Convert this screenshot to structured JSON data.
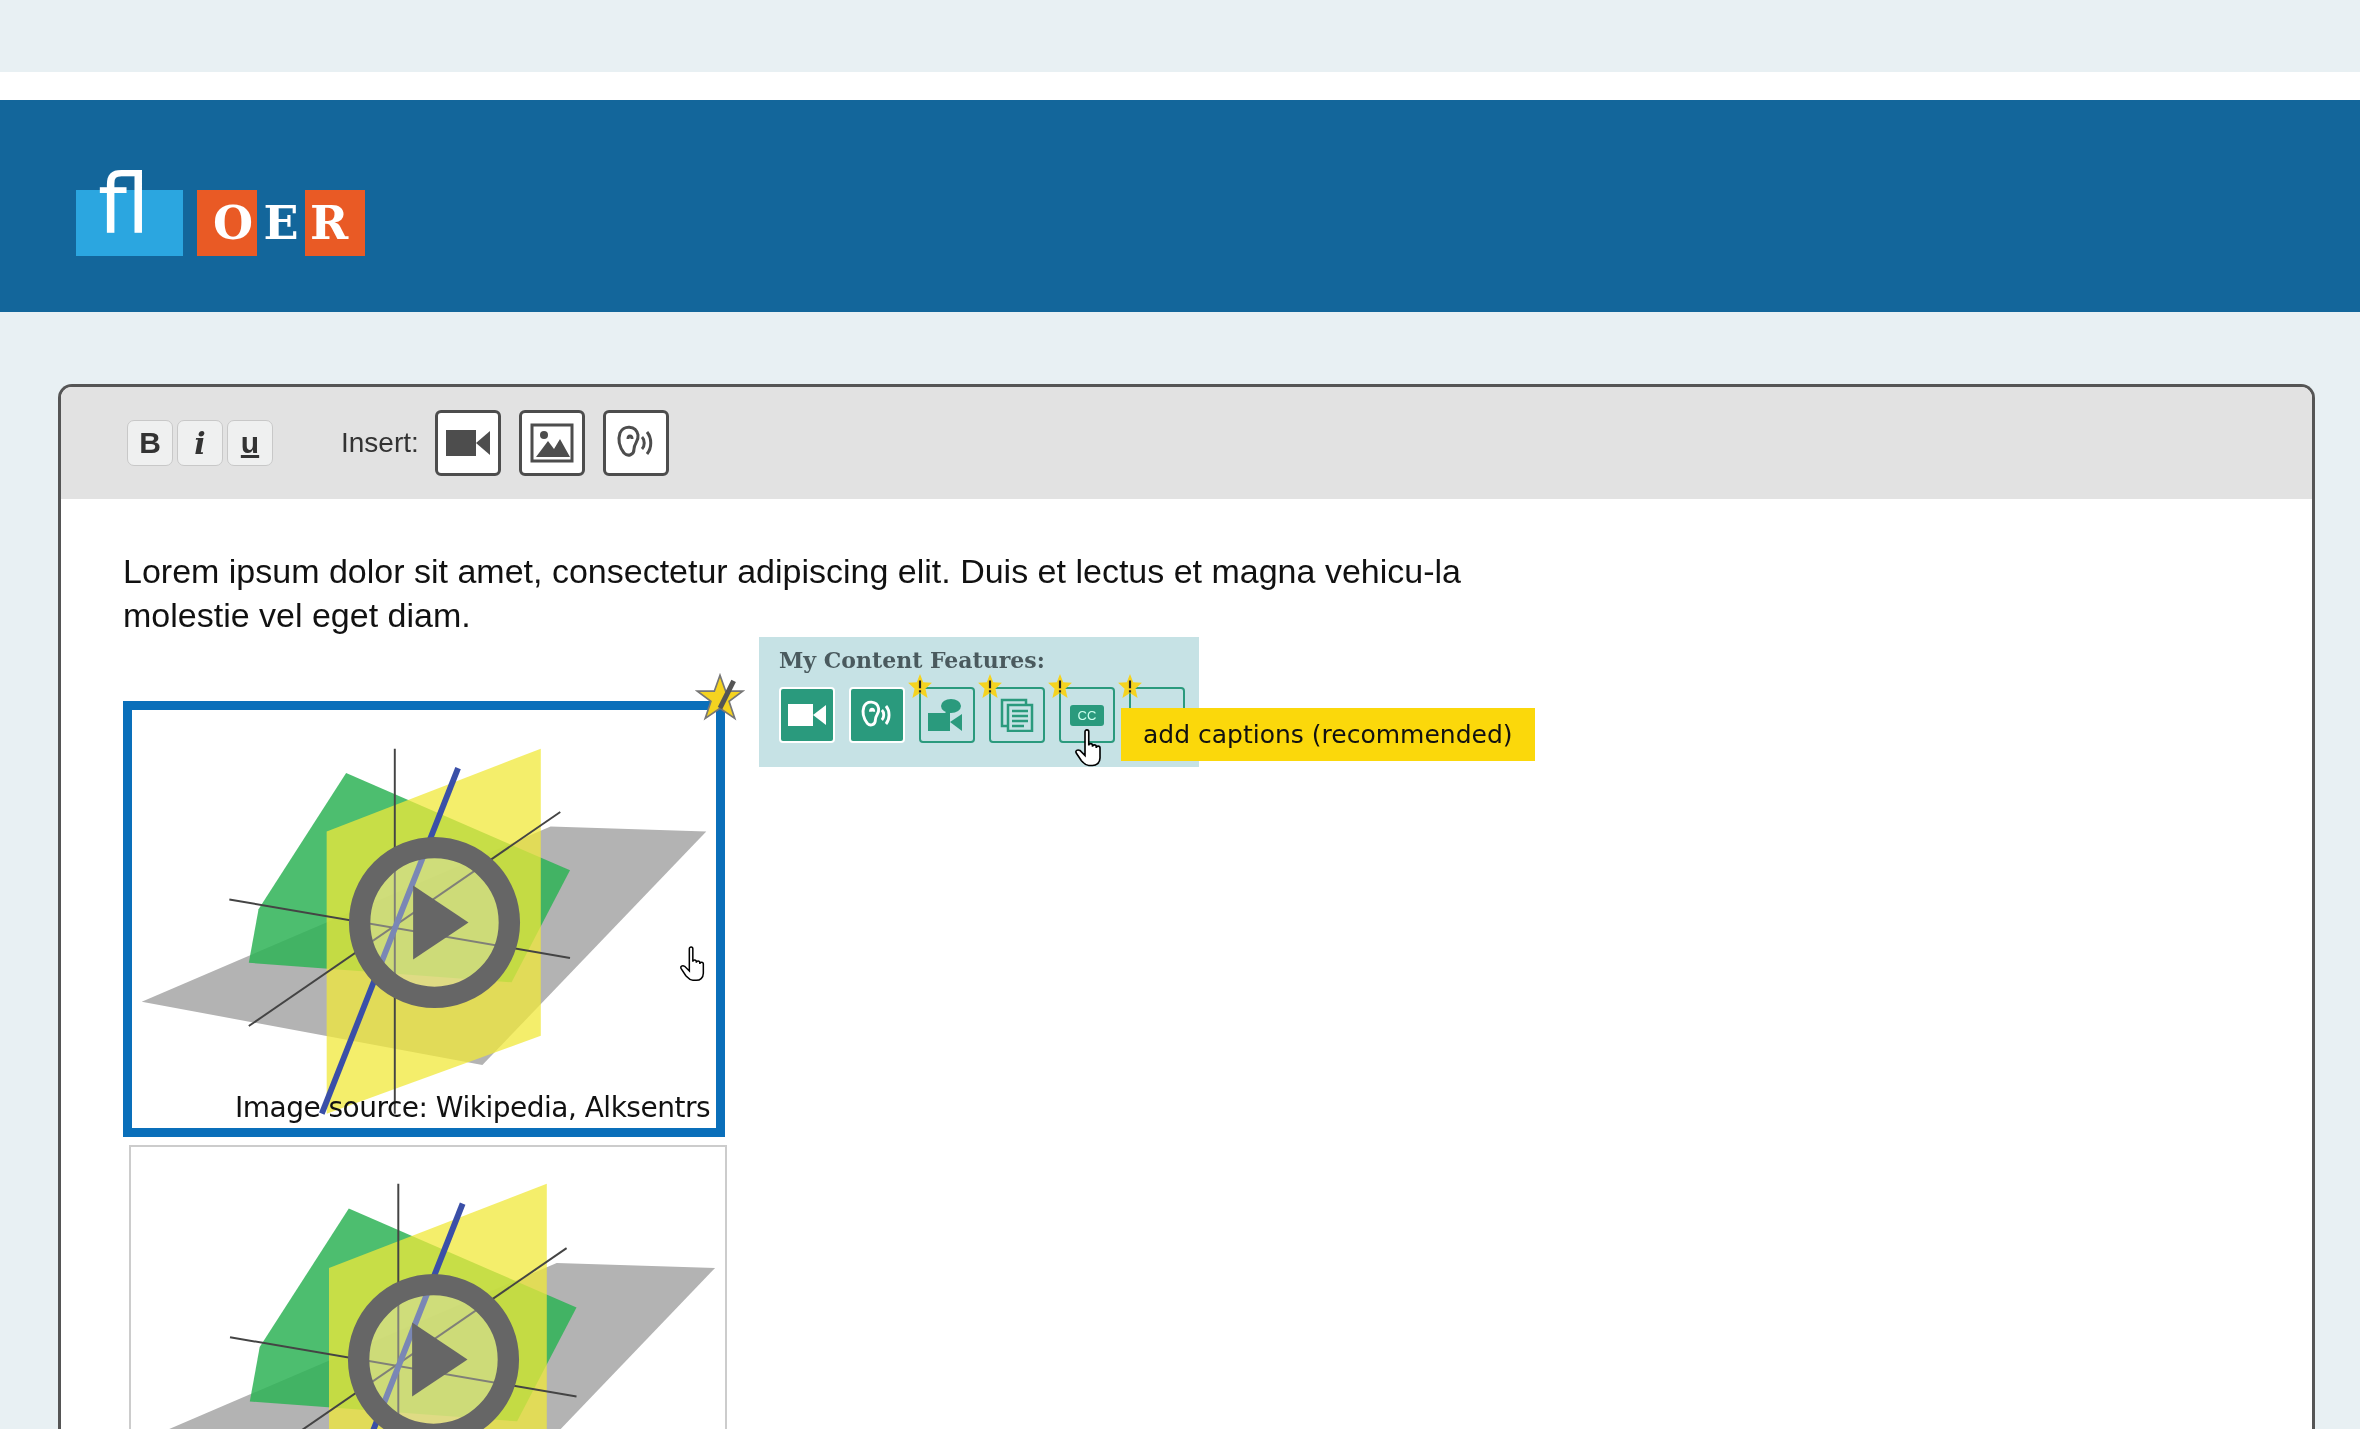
{
  "logo": {
    "mark": "fl",
    "letters": [
      "O",
      "E",
      "R"
    ]
  },
  "toolbar": {
    "format_buttons": [
      {
        "label": "B",
        "kind": "bold"
      },
      {
        "label": "i",
        "kind": "italic"
      },
      {
        "label": "u",
        "kind": "underline"
      }
    ],
    "insert_label": "Insert:",
    "insert_buttons": [
      {
        "kind": "video"
      },
      {
        "kind": "image"
      },
      {
        "kind": "audio"
      }
    ]
  },
  "body_text": "Lorem ipsum dolor sit amet, consectetur adipiscing elit. Duis et lectus et magna vehicu-la molestie vel eget diam.",
  "features_panel": {
    "title": "My Content Features:",
    "features": [
      {
        "kind": "video",
        "active": true,
        "warning": false
      },
      {
        "kind": "audio",
        "active": true,
        "warning": false
      },
      {
        "kind": "sign-video",
        "active": false,
        "warning": true
      },
      {
        "kind": "transcript",
        "active": false,
        "warning": true
      },
      {
        "kind": "captions",
        "label": "CC",
        "active": false,
        "warning": true
      },
      {
        "kind": "unknown",
        "active": false,
        "warning": true
      }
    ],
    "tooltip": "add captions (recommended)"
  },
  "media": [
    {
      "selected": true,
      "caption": "Image source: Wikipedia, Alksentrs"
    },
    {
      "selected": false
    }
  ]
}
